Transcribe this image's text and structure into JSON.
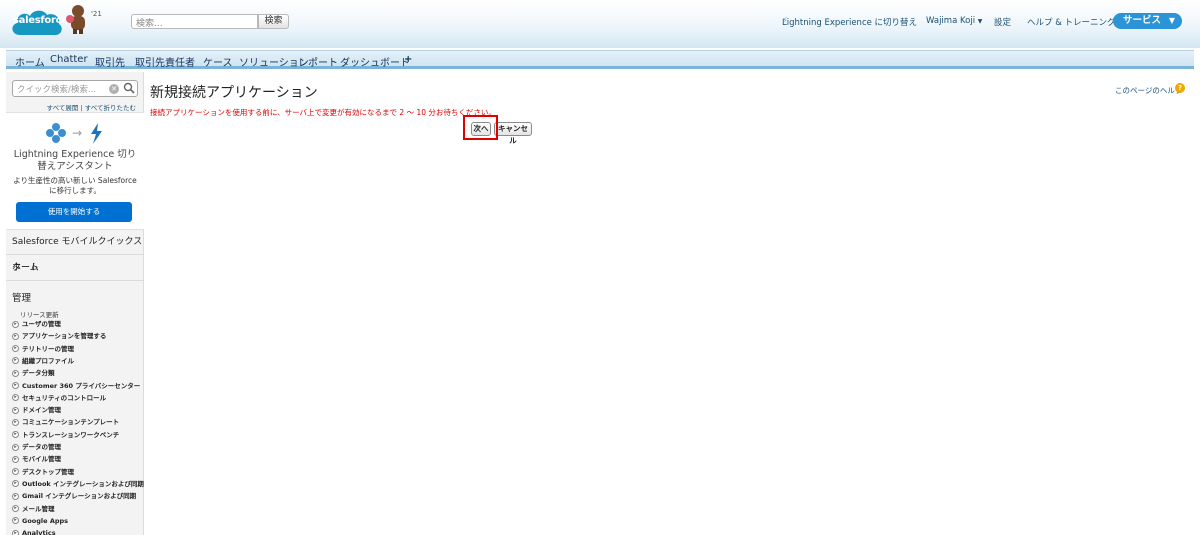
{
  "header": {
    "logo_text": "salesforce",
    "release_badge": "'21",
    "search_placeholder": "検索...",
    "search_button": "検索",
    "lightning_switch": "Lightning Experience に切り替え",
    "user_menu": "Wajima Koji",
    "user_menu_caret": "▼",
    "setup": "設定",
    "help_training": "ヘルプ & トレーニング",
    "app_picker": "サービス"
  },
  "tabs": [
    "ホーム",
    "Chatter",
    "取引先",
    "取引先責任者",
    "ケース",
    "ソリューション",
    "レポート",
    "ダッシュボード",
    "+"
  ],
  "sidebar": {
    "quickfind_placeholder": "クイック検索/検索...",
    "expand_all": "すべて展開",
    "collapse_all": "すべて折りたたむ",
    "separator": "|",
    "lightning_box": {
      "title": "Lightning Experience 切り替えアシスタント",
      "description": "より生産性の高い新しい Salesforce に移行します。",
      "button": "使用を開始する"
    },
    "mobile_quickstart": "Salesforce モバイルクイックスタート",
    "home": "ホーム",
    "management": "管理",
    "release_updates": "リリース更新",
    "tree_items": [
      "ユーザの管理",
      "アプリケーションを管理する",
      "テリトリーの管理",
      "組織プロファイル",
      "データ分類",
      "Customer 360 プライバシーセンター",
      "セキュリティのコントロール",
      "ドメイン管理",
      "コミュニケーションテンプレート",
      "トランスレーションワークベンチ",
      "データの管理",
      "モバイル管理",
      "デスクトップ管理",
      "Outlook インテグレーションおよび同期",
      "Gmail インテグレーションおよび同期",
      "メール管理",
      "Google Apps",
      "Analytics"
    ]
  },
  "main": {
    "title": "新規接続アプリケーション",
    "help_link": "このページのヘルプ",
    "help_icon": "?",
    "warning": "接続アプリケーションを使用する前に、サーバ上で変更が有効になるまで 2 〜 10 分お待ちください。",
    "next_button": "次へ",
    "cancel_button": "キャンセル"
  }
}
